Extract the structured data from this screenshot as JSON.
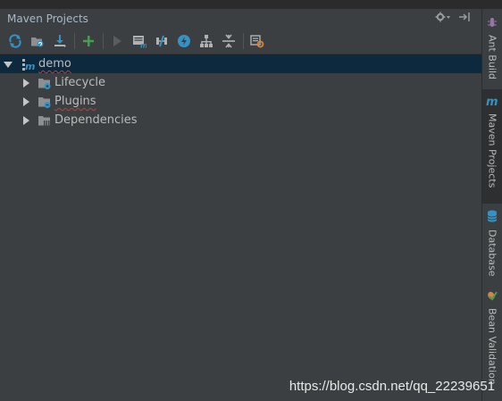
{
  "panel": {
    "title": "Maven Projects"
  },
  "toolbar": {
    "buttons": [
      {
        "icon": "reimport-icon"
      },
      {
        "icon": "generate-sources-icon"
      },
      {
        "icon": "download-icon"
      },
      {
        "icon": "add-maven-project-icon"
      },
      {
        "icon": "run-icon"
      },
      {
        "icon": "execute-goal-icon"
      },
      {
        "icon": "toggle-offline-icon"
      },
      {
        "icon": "skip-tests-icon"
      },
      {
        "icon": "show-dependencies-icon"
      },
      {
        "icon": "collapse-all-icon"
      },
      {
        "icon": "settings-icon"
      }
    ]
  },
  "tree": {
    "root": {
      "label": "demo",
      "expanded": true
    },
    "children": [
      {
        "label": "Lifecycle"
      },
      {
        "label": "Plugins"
      },
      {
        "label": "Dependencies"
      }
    ]
  },
  "sidebar": {
    "tabs": [
      {
        "label": "Ant Build"
      },
      {
        "label": "Maven Projects",
        "active": true
      },
      {
        "label": "Database"
      },
      {
        "label": "Bean Validation"
      }
    ]
  },
  "watermark": "https://blog.csdn.net/qq_22239651",
  "colors": {
    "background": "#3c3f41",
    "selection": "#0d293e",
    "accent_blue": "#3592c4",
    "green": "#499c54"
  }
}
